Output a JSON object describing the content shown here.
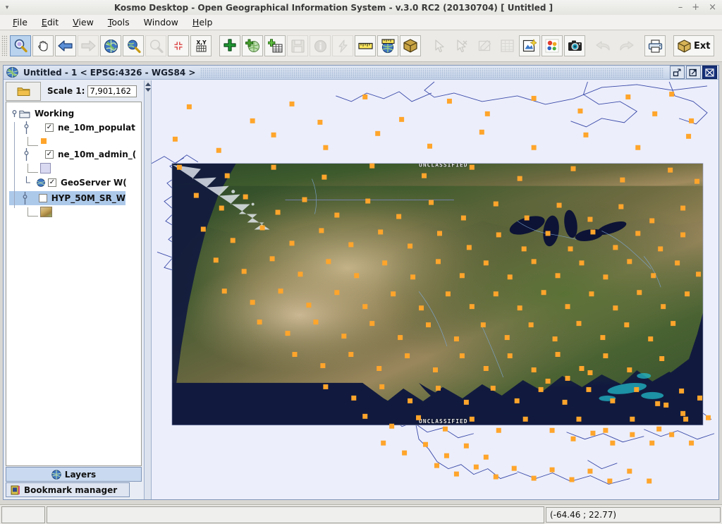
{
  "window": {
    "title": "Kosmo Desktop - Open Geographical Information System - v.3.0 RC2 (20130704)  [ Untitled ]",
    "minimize": "–",
    "maximize": "+",
    "close": "×",
    "menu_arrow": "▾"
  },
  "menubar": {
    "items": [
      {
        "label": "File",
        "mnemonic": "F"
      },
      {
        "label": "Edit",
        "mnemonic": "E"
      },
      {
        "label": "View",
        "mnemonic": "V"
      },
      {
        "label": "Tools",
        "mnemonic": "T"
      },
      {
        "label": "Window",
        "mnemonic": "W"
      },
      {
        "label": "Help",
        "mnemonic": "H"
      }
    ]
  },
  "toolbar": {
    "ext_label": "Ext",
    "buttons": [
      {
        "name": "zoom-in-tool",
        "selected": true,
        "enabled": true
      },
      {
        "name": "pan-tool",
        "selected": false,
        "enabled": true
      },
      {
        "name": "previous-extent",
        "selected": false,
        "enabled": true
      },
      {
        "name": "next-extent",
        "selected": false,
        "enabled": false
      },
      {
        "name": "zoom-full-extent",
        "selected": false,
        "enabled": true
      },
      {
        "name": "zoom-to-layer",
        "selected": false,
        "enabled": true
      },
      {
        "name": "zoom-to-selection",
        "selected": false,
        "enabled": false
      },
      {
        "name": "zoom-to-center",
        "selected": false,
        "enabled": true
      },
      {
        "name": "goto-xy",
        "selected": false,
        "enabled": true
      },
      {
        "name": "add-layer",
        "selected": false,
        "enabled": true
      },
      {
        "name": "add-wms-layer",
        "selected": false,
        "enabled": true
      },
      {
        "name": "add-table-layer",
        "selected": false,
        "enabled": true
      },
      {
        "name": "save-layer",
        "selected": false,
        "enabled": false
      },
      {
        "name": "feature-info",
        "selected": false,
        "enabled": false
      },
      {
        "name": "flash-feature",
        "selected": false,
        "enabled": false
      },
      {
        "name": "measure-distance",
        "selected": false,
        "enabled": true
      },
      {
        "name": "measure-geodetic",
        "selected": false,
        "enabled": true
      },
      {
        "name": "3d-view",
        "selected": false,
        "enabled": true
      },
      {
        "name": "select-features",
        "selected": false,
        "enabled": false
      },
      {
        "name": "deselect-features",
        "selected": false,
        "enabled": false
      },
      {
        "name": "edit-geometry",
        "selected": false,
        "enabled": false
      },
      {
        "name": "attribute-table",
        "selected": false,
        "enabled": false
      },
      {
        "name": "new-map-view",
        "selected": false,
        "enabled": true
      },
      {
        "name": "symbology",
        "selected": false,
        "enabled": true
      },
      {
        "name": "screenshot",
        "selected": false,
        "enabled": true
      },
      {
        "name": "undo",
        "selected": false,
        "enabled": false
      },
      {
        "name": "redo",
        "selected": false,
        "enabled": false
      },
      {
        "name": "print",
        "selected": false,
        "enabled": true
      },
      {
        "name": "extensions",
        "selected": false,
        "enabled": true
      }
    ]
  },
  "map_frame": {
    "title": "Untitled - 1 < EPSG:4326 - WGS84 >",
    "restore_tooltip": "Restore",
    "maximize_tooltip": "Maximize",
    "close_tooltip": "Close"
  },
  "scale": {
    "label": "Scale 1:",
    "value": "7,901,162",
    "folder_button": "open-project"
  },
  "layers": {
    "root": "Working",
    "items": [
      {
        "label": "ne_10m_populat",
        "checked": true,
        "selected": false,
        "symbol_color": "#ffa52b",
        "symbol_type": "point"
      },
      {
        "label": "ne_10m_admin_(",
        "checked": true,
        "selected": false,
        "symbol_color": "#d9d9f1",
        "symbol_type": "polygon"
      },
      {
        "label": "GeoServer W(",
        "checked": true,
        "selected": false,
        "symbol_type": "wms"
      },
      {
        "label": "HYP_50M_SR_W",
        "checked": false,
        "selected": true,
        "symbol_type": "raster"
      }
    ]
  },
  "panel_buttons": {
    "layers": "Layers",
    "bookmark_manager": "Bookmark manager"
  },
  "map": {
    "watermark": "UNCLASSIFIED",
    "background_color": "#eceefb",
    "point_color": "#ffa52b",
    "boundary_color": "#3a4aa8"
  },
  "statusbar": {
    "message": "",
    "coordinates": "(-64.46 ; 22.77)"
  }
}
